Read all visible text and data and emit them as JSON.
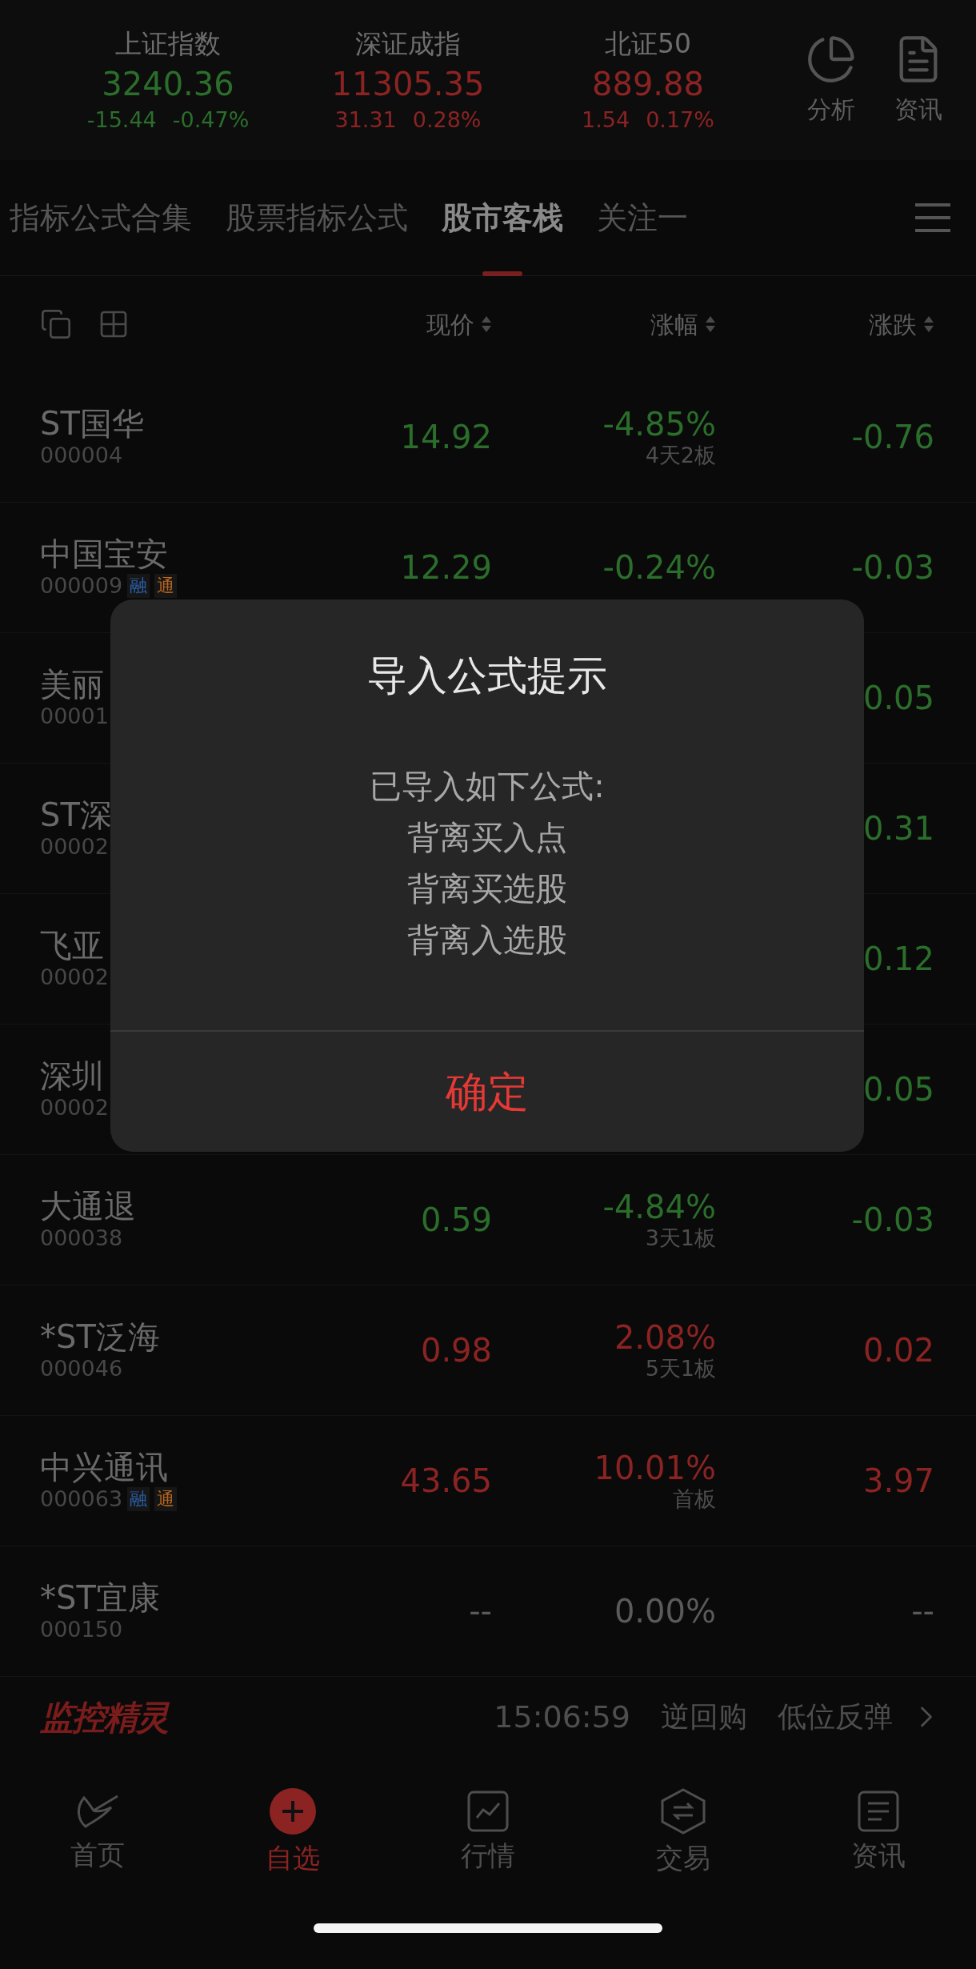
{
  "indices": [
    {
      "name": "上证指数",
      "value": "3240.36",
      "change": "-15.44",
      "percent": "-0.47%",
      "color": "#2b6e2b"
    },
    {
      "name": "深证成指",
      "value": "11305.35",
      "change": "31.31",
      "percent": "0.28%",
      "color": "#8c2323"
    },
    {
      "name": "北证50",
      "value": "889.88",
      "change": "1.54",
      "percent": "0.17%",
      "color": "#8c2323"
    }
  ],
  "header_actions": [
    {
      "label": "分析"
    },
    {
      "label": "资讯"
    }
  ],
  "tabs": [
    {
      "label": "指标公式合集",
      "selected": false
    },
    {
      "label": "股票指标公式",
      "selected": false
    },
    {
      "label": "股市客栈",
      "selected": true
    },
    {
      "label": "关注一",
      "selected": false
    }
  ],
  "columns": [
    {
      "label": "现价"
    },
    {
      "label": "涨幅"
    },
    {
      "label": "涨跌"
    }
  ],
  "rows": [
    {
      "name": "ST国华",
      "code": "000004",
      "price": "14.92",
      "percent": "-4.85%",
      "note": "4天2板",
      "change": "-0.76",
      "color": "#2b6e2b"
    },
    {
      "name": "中国宝安",
      "code": "000009",
      "tags": [
        {
          "label": "融",
          "color": "#2b5fa8"
        },
        {
          "label": "通",
          "color": "#b8661f"
        }
      ],
      "price": "12.29",
      "percent": "-0.24%",
      "change": "-0.03",
      "color": "#2b6e2b"
    },
    {
      "name": "美丽",
      "code": "00001",
      "change": "0.05",
      "color": "#2b6e2b"
    },
    {
      "name": "ST深",
      "code": "00002",
      "change": "0.31",
      "color": "#2b6e2b"
    },
    {
      "name": "飞亚",
      "code": "00002",
      "change": "0.12",
      "color": "#2b6e2b"
    },
    {
      "name": "深圳",
      "code": "00002",
      "change": "0.05",
      "color": "#2b6e2b"
    },
    {
      "name": "大通退",
      "code": "000038",
      "price": "0.59",
      "percent": "-4.84%",
      "note": "3天1板",
      "change": "-0.03",
      "color": "#2b6e2b"
    },
    {
      "name": "*ST泛海",
      "code": "000046",
      "price": "0.98",
      "percent": "2.08%",
      "note": "5天1板",
      "change": "0.02",
      "color": "#8c2323"
    },
    {
      "name": "中兴通讯",
      "code": "000063",
      "tags": [
        {
          "label": "融",
          "color": "#2b5fa8"
        },
        {
          "label": "通",
          "color": "#b8661f"
        }
      ],
      "price": "43.65",
      "percent": "10.01%",
      "note": "首板",
      "change": "3.97",
      "color": "#8c2323"
    },
    {
      "name": "*ST宜康",
      "code": "000150",
      "price": "--",
      "percent": "0.00%",
      "change": "--",
      "color": "#5a5a5a"
    }
  ],
  "monitor": {
    "logo": "监控精灵",
    "time": "15:06:59",
    "items": [
      "逆回购",
      "低位反弹"
    ]
  },
  "nav": [
    {
      "label": "首页",
      "selected": false
    },
    {
      "label": "自选",
      "selected": true
    },
    {
      "label": "行情",
      "selected": false
    },
    {
      "label": "交易",
      "selected": false
    },
    {
      "label": "资讯",
      "selected": false
    }
  ],
  "dialog": {
    "title": "导入公式提示",
    "lines": [
      "已导入如下公式:",
      "背离买入点",
      "背离买选股",
      "背离入选股"
    ],
    "button": "确定"
  }
}
